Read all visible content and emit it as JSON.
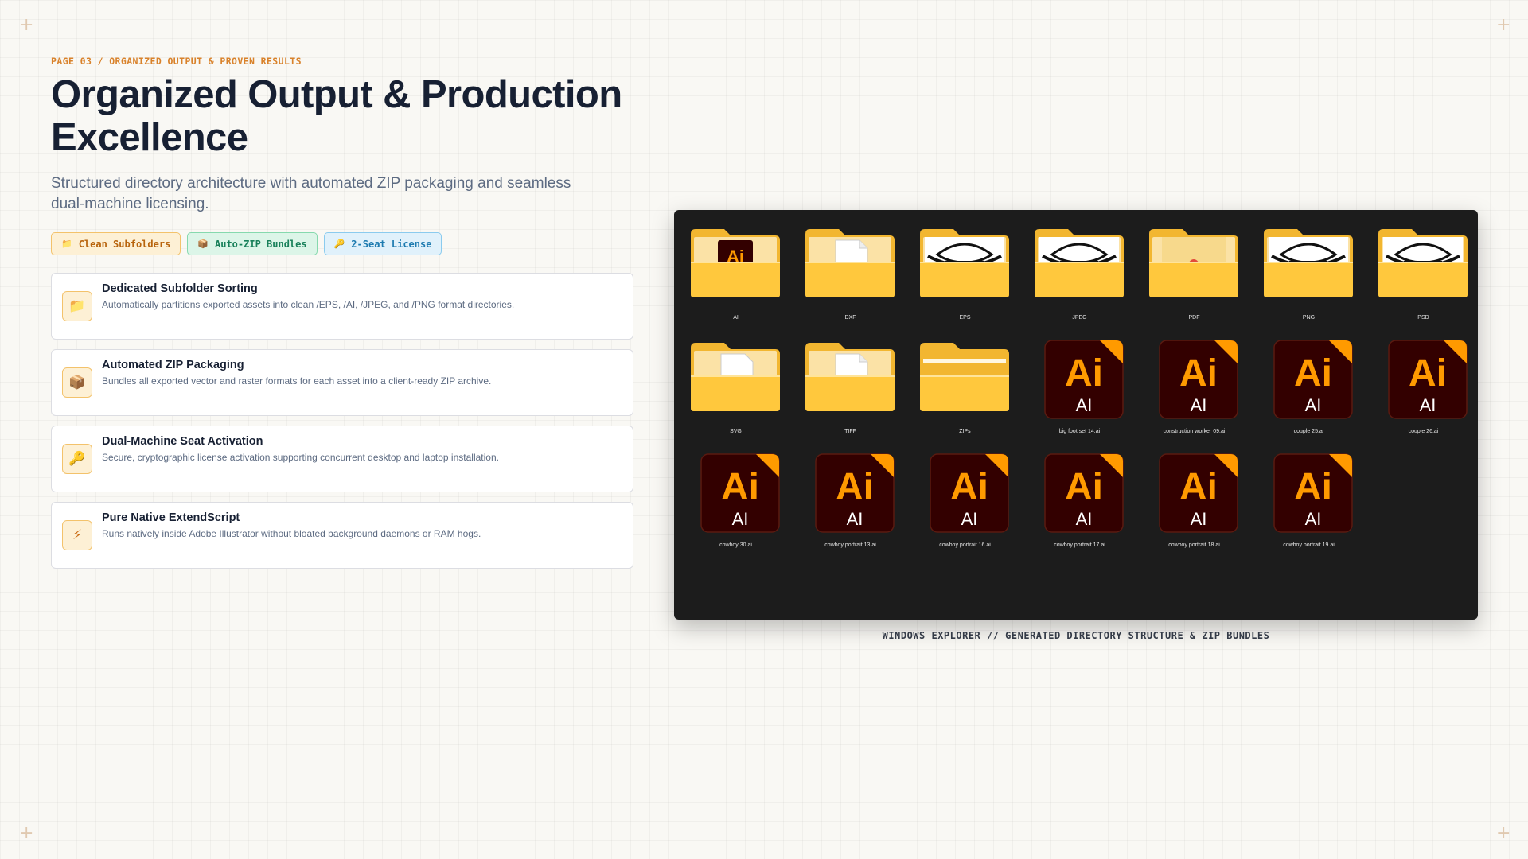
{
  "header": {
    "kicker": "PAGE 03 / ORGANIZED OUTPUT & PROVEN RESULTS",
    "title_line1": "Organized Output & Production",
    "title_line2": "Excellence",
    "subtitle_line1": "Structured directory architecture with automated ZIP packaging and seamless",
    "subtitle_line2": "dual-machine licensing."
  },
  "tags": [
    {
      "icon": "folder-icon",
      "glyph": "📁",
      "label": "Clean Subfolders"
    },
    {
      "icon": "package-icon",
      "glyph": "📦",
      "label": "Auto-ZIP Bundles"
    },
    {
      "icon": "key-icon",
      "glyph": "🔑",
      "label": "2-Seat License"
    }
  ],
  "features": [
    {
      "icon": "folder-icon",
      "glyph": "📁",
      "title": "Dedicated Subfolder Sorting",
      "desc": "Automatically partitions exported assets into clean /EPS, /AI, /JPEG, and /PNG format directories."
    },
    {
      "icon": "package-icon",
      "glyph": "📦",
      "title": "Automated ZIP Packaging",
      "desc": "Bundles all exported vector and raster formats for each asset into a client-ready ZIP archive."
    },
    {
      "icon": "key-icon",
      "glyph": "🔑",
      "title": "Dual-Machine Seat Activation",
      "desc": "Secure, cryptographic license activation supporting concurrent desktop and laptop installation."
    },
    {
      "icon": "lightning-icon",
      "glyph": "⚡",
      "title": "Pure Native ExtendScript",
      "desc": "Runs natively inside Adobe Illustrator without bloated background daemons or RAM hogs."
    }
  ],
  "explorer": {
    "caption": "WINDOWS EXPLORER // GENERATED DIRECTORY STRUCTURE & ZIP BUNDLES",
    "folders": [
      {
        "name": "AI",
        "preview": "ai"
      },
      {
        "name": "DXF",
        "preview": "doc"
      },
      {
        "name": "EPS",
        "preview": "hat"
      },
      {
        "name": "JPEG",
        "preview": "hat"
      },
      {
        "name": "PDF",
        "preview": "pdf"
      },
      {
        "name": "PNG",
        "preview": "hat"
      },
      {
        "name": "PSD",
        "preview": "hat"
      },
      {
        "name": "SVG",
        "preview": "svg"
      },
      {
        "name": "TIFF",
        "preview": "doc"
      },
      {
        "name": "ZIPs",
        "preview": "empty"
      }
    ],
    "files": [
      {
        "name": "big foot set 14.ai"
      },
      {
        "name": "construction worker 09.ai"
      },
      {
        "name": "couple 25.ai"
      },
      {
        "name": "couple 26.ai"
      },
      {
        "name": "cowboy 30.ai"
      },
      {
        "name": "cowboy portrait 13.ai"
      },
      {
        "name": "cowboy portrait 16.ai"
      },
      {
        "name": "cowboy portrait 17.ai"
      },
      {
        "name": "cowboy portrait 18.ai"
      },
      {
        "name": "cowboy portrait 19.ai"
      }
    ],
    "ai_badge": "Ai",
    "ai_ext": "AI"
  },
  "colors": {
    "accent": "#d9822b",
    "folder_yellow": "#ffc83d",
    "ai_orange": "#ff9a00",
    "ai_dark": "#330000",
    "explorer_bg": "#1c1c1c"
  }
}
